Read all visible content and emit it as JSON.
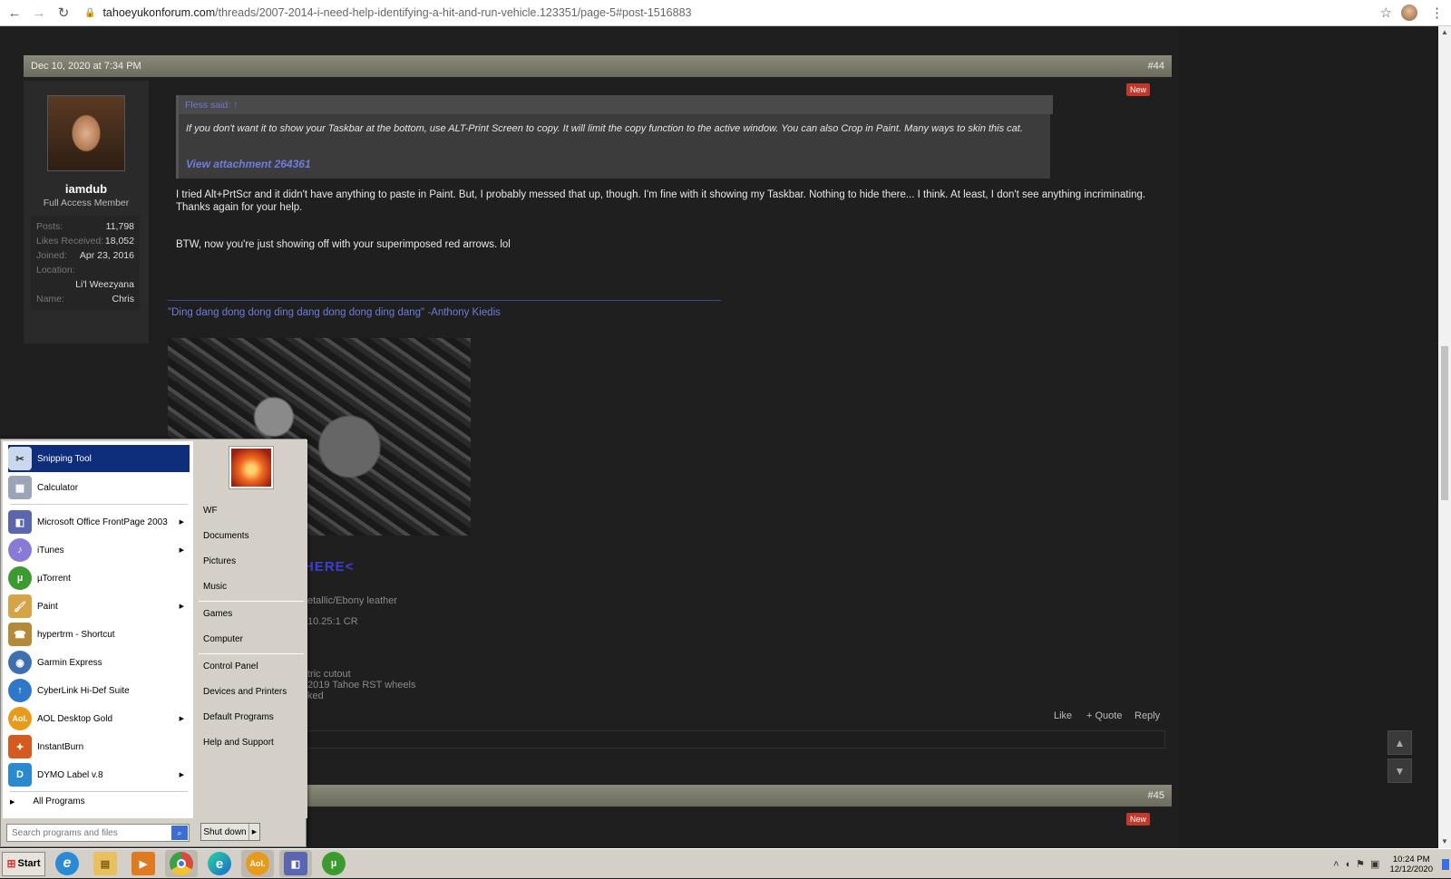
{
  "browser": {
    "url_domain": "tahoeyukonforum.com",
    "url_path": "/threads/2007-2014-i-need-help-identifying-a-hit-and-run-vehicle.123351/page-5#post-1516883"
  },
  "post44": {
    "date": "Dec 10, 2020 at 7:34 PM",
    "number": "#44",
    "new_badge": "New",
    "user": {
      "name": "iamdub",
      "title": "Full Access Member",
      "stats": [
        {
          "label": "Posts:",
          "value": "11,798"
        },
        {
          "label": "Likes Received:",
          "value": "18,052"
        },
        {
          "label": "Joined:",
          "value": "Apr 23, 2016"
        },
        {
          "label": "Location:",
          "value": ""
        }
      ],
      "location": "Li'l Weezyana",
      "name_label": "Name:",
      "name_value": "Chris"
    },
    "quote": {
      "header": "Fless said: ↑",
      "text": "If you don't want it to show your Taskbar at the bottom, use ALT-Print Screen to copy. It will limit the copy function to the active window. You can also Crop in Paint. Many ways to skin this cat.",
      "attachment": "View attachment 264361"
    },
    "message1": "I tried Alt+PrtScr and it didn't have anything to paste in Paint. But, I probably messed that up, though. I'm fine with it showing my Taskbar. Nothing to hide there... I think. At least, I don't see anything incriminating. Thanks again for your help.",
    "message2": "BTW, now you're just showing off with your superimposed red arrows. lol",
    "signature": {
      "quote": "\"Ding dang dong dong ding dang dong dong ding dang\" -Anthony Kiedis",
      "here_link": "HERE<",
      "lines": [
        "etallic/Ebony leather",
        "10.25:1 CR",
        "tric cutout",
        "2019 Tahoe RST wheels",
        "ked"
      ]
    },
    "actions": {
      "like": "Like",
      "quote": "+ Quote",
      "reply": "Reply"
    }
  },
  "post45": {
    "number": "#45",
    "new_badge": "New"
  },
  "start_menu": {
    "pinned": [
      {
        "label": "Snipping Tool",
        "icon": "scissors-icon",
        "color": "#c9d7ef"
      },
      {
        "label": "Calculator",
        "icon": "calculator-icon",
        "color": "#9aa6b8"
      }
    ],
    "programs": [
      {
        "label": "Microsoft Office FrontPage 2003",
        "icon": "frontpage-icon",
        "color": "#5b66b0",
        "arrow": true
      },
      {
        "label": "iTunes",
        "icon": "itunes-icon",
        "color": "#8a7ad8",
        "arrow": true
      },
      {
        "label": "µTorrent",
        "icon": "utorrent-icon",
        "color": "#3c9b2f",
        "arrow": false
      },
      {
        "label": "Paint",
        "icon": "paint-icon",
        "color": "#d5a447",
        "arrow": true
      },
      {
        "label": "hypertrm - Shortcut",
        "icon": "hyperterminal-icon",
        "color": "#b48a3a",
        "arrow": false
      },
      {
        "label": "Garmin Express",
        "icon": "garmin-icon",
        "color": "#3e6fb0",
        "arrow": false
      },
      {
        "label": "CyberLink Hi-Def Suite",
        "icon": "cyberlink-icon",
        "color": "#2f78c8",
        "arrow": false
      },
      {
        "label": "AOL Desktop Gold",
        "icon": "aol-icon",
        "color": "#e89a1a",
        "arrow": true
      },
      {
        "label": "InstantBurn",
        "icon": "instantburn-icon",
        "color": "#d45a20",
        "arrow": false
      },
      {
        "label": "DYMO Label v.8",
        "icon": "dymo-icon",
        "color": "#2a8ad0",
        "arrow": true
      }
    ],
    "all_programs": "All Programs",
    "search_placeholder": "Search programs and files",
    "right": [
      "WF",
      "Documents",
      "Pictures",
      "Music",
      "Games",
      "Computer",
      "Control Panel",
      "Devices and Printers",
      "Default Programs",
      "Help and Support"
    ],
    "shutdown": "Shut down"
  },
  "taskbar": {
    "start": "Start",
    "apps": [
      {
        "name": "internet-explorer-icon",
        "color": "#2a8ad8",
        "glyph": "e"
      },
      {
        "name": "file-explorer-icon",
        "color": "#e8c060",
        "glyph": ""
      },
      {
        "name": "media-player-icon",
        "color": "#e07a20",
        "glyph": "▶"
      },
      {
        "name": "chrome-icon",
        "color": "#d84a3a",
        "glyph": ""
      },
      {
        "name": "edge-icon",
        "color": "#2a9ad0",
        "glyph": ""
      },
      {
        "name": "aol-icon",
        "color": "#e89a1a",
        "glyph": "Aol."
      },
      {
        "name": "frontpage-icon",
        "color": "#5b66b0",
        "glyph": ""
      },
      {
        "name": "utorrent-icon",
        "color": "#3c9b2f",
        "glyph": "µ"
      }
    ],
    "time": "10:24 PM",
    "date": "12/12/2020"
  }
}
